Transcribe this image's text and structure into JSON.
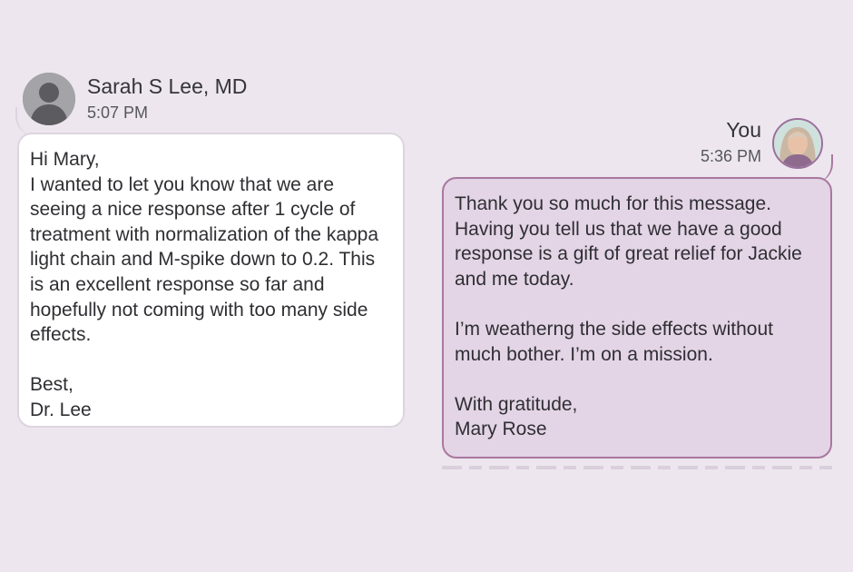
{
  "conversation": {
    "incoming": {
      "avatar_icon": "default-person-avatar-icon",
      "sender_name": "Sarah S Lee, MD",
      "time": "5:07 PM",
      "body": "Hi Mary,\nI wanted to let you know that we are seeing a nice response after 1 cycle of treatment with normalization of the kappa light chain and M-spike down to 0.2. This is an excellent response so far and hopefully not coming with too many side effects.\n\nBest,\nDr. Lee"
    },
    "outgoing": {
      "avatar_icon": "user-photo-avatar",
      "sender_name": "You",
      "time": "5:36 PM",
      "body": "Thank you so much for this message. Having you tell us that we have a good response is a gift of great relief for Jackie and me today.\n\nI’m weatherng the side effects without much bother. I’m on a mission.\n\nWith gratitude,\nMary Rose"
    }
  },
  "colors": {
    "background": "#ede6ee",
    "incoming_bubble": "#ffffff",
    "outgoing_bubble": "#e3d4e6",
    "outgoing_border": "#a9789f"
  }
}
